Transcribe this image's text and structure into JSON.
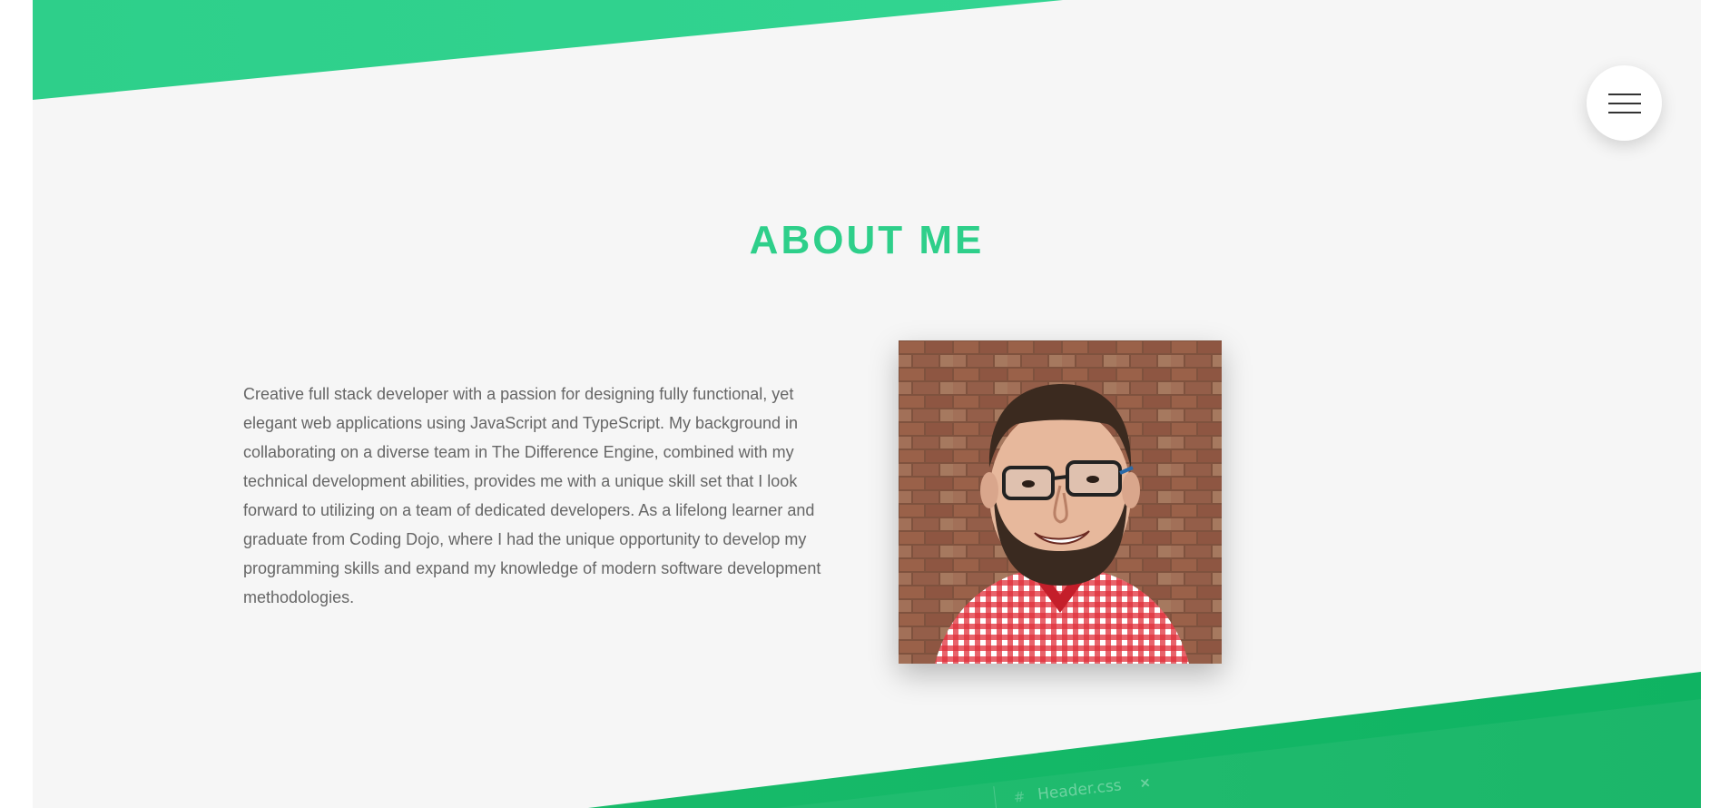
{
  "nav": {
    "menu_icon": "hamburger-menu-icon"
  },
  "about": {
    "title": "ABOUT ME",
    "bio": "Creative full stack developer with a passion for designing fully functional, yet elegant web applications using JavaScript and TypeScript. My background in collaborating on a diverse team in The Difference Engine, combined with my technical development abilities, provides me with a unique skill set that I look forward to utilizing on a team of dedicated developers. As a lifelong learner and graduate from Coding Dojo, where I had the unique opportunity to develop my programming skills and expand my knowledge of modern software development methodologies.",
    "photo_icon": "profile-photo"
  },
  "decor": {
    "code_tab_name": "Header.css",
    "code_tab_hash": "#",
    "code_tab_close": "×"
  },
  "colors": {
    "accent": "#2ecf8a",
    "band_bottom": "#0fb362",
    "background": "#f6f6f6",
    "text": "#666666"
  }
}
